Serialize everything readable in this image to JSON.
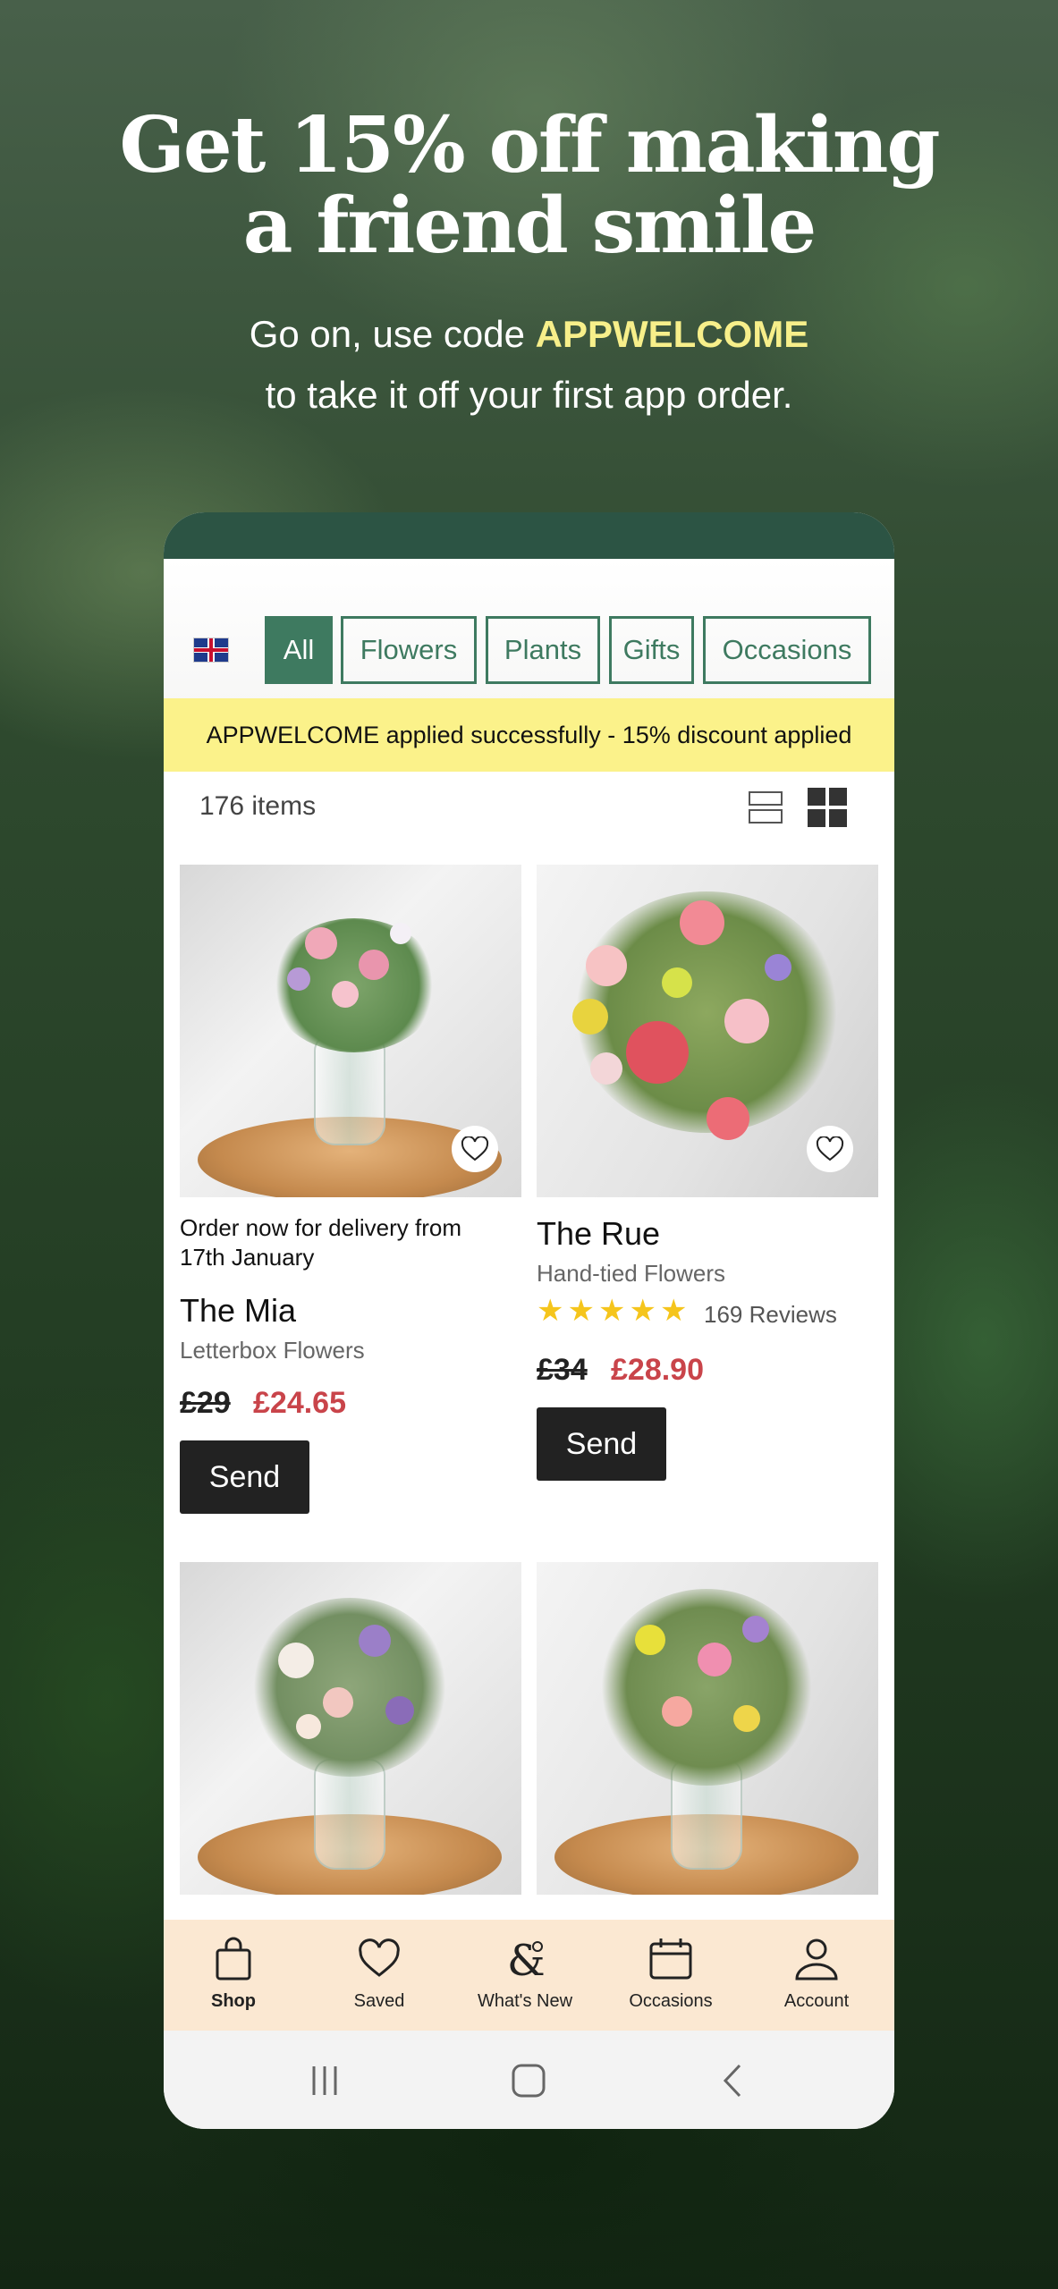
{
  "hero": {
    "title_line1": "Get 15% off making",
    "title_line2": "a friend smile",
    "sub_prefix": "Go on, use code ",
    "sub_code": "APPWELCOME",
    "sub_line2": "to take it off your first app order."
  },
  "filters": {
    "flag_icon": "uk-flag-icon",
    "chips": [
      {
        "label": "All",
        "active": true
      },
      {
        "label": "Flowers"
      },
      {
        "label": "Plants"
      },
      {
        "label": "Gifts"
      },
      {
        "label": "Occasions"
      }
    ]
  },
  "banner": {
    "text": "APPWELCOME applied successfully - 15% discount applied"
  },
  "results": {
    "count": "176 items"
  },
  "products": [
    {
      "delivery": "Order now for delivery from 17th January",
      "name": "The Mia",
      "type": "Letterbox Flowers",
      "old_price": "£29",
      "new_price": "£24.65",
      "send": "Send"
    },
    {
      "name": "The Rue",
      "type": "Hand-tied Flowers",
      "rating": 5,
      "reviews": "169 Reviews",
      "old_price": "£34",
      "new_price": "£28.90",
      "send": "Send"
    }
  ],
  "tabbar": {
    "items": [
      {
        "label": "Shop",
        "icon": "shopping-bag-icon",
        "active": true
      },
      {
        "label": "Saved",
        "icon": "heart-icon"
      },
      {
        "label": "What's New",
        "icon": "ampersand-flower-icon"
      },
      {
        "label": "Occasions",
        "icon": "calendar-icon"
      },
      {
        "label": "Account",
        "icon": "user-icon"
      }
    ]
  },
  "colors": {
    "brand_green": "#3e7a60",
    "banner_yellow": "#fbf28a",
    "sale_red": "#c9444a",
    "tabbar_bg": "#fbe8d2",
    "code_yellow": "#f7ef8a"
  }
}
